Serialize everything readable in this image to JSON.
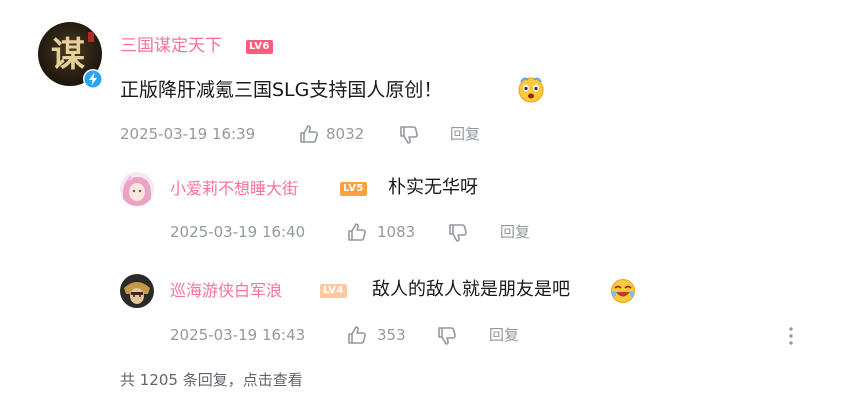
{
  "comment": {
    "username": "三国谋定天下",
    "level_badge": "LV6",
    "text": "正版降肝减氪三国SLG支持国人原创！",
    "time": "2025-03-19 16:39",
    "likes": "8032",
    "reply_label": "回复"
  },
  "replies": [
    {
      "username": "小爱莉不想睡大街",
      "level_badge": "LV5",
      "text": "朴实无华呀",
      "time": "2025-03-19 16:40",
      "likes": "1083",
      "reply_label": "回复"
    },
    {
      "username": "巡海游侠白军浪",
      "level_badge": "LV4",
      "text": "敌人的敌人就是朋友是吧",
      "time": "2025-03-19 16:43",
      "likes": "353",
      "reply_label": "回复"
    }
  ],
  "reply_summary": "共 1205 条回复，点击查看",
  "colors": {
    "username": "#fb7299",
    "meta_text": "#9499a0",
    "content_text": "#18191c",
    "verified_badge": "#2aa4f4"
  },
  "icons": {
    "like": "thumbs-up-icon",
    "dislike": "thumbs-down-icon",
    "more": "more-vertical-icon",
    "verified": "verified-badge-icon"
  }
}
